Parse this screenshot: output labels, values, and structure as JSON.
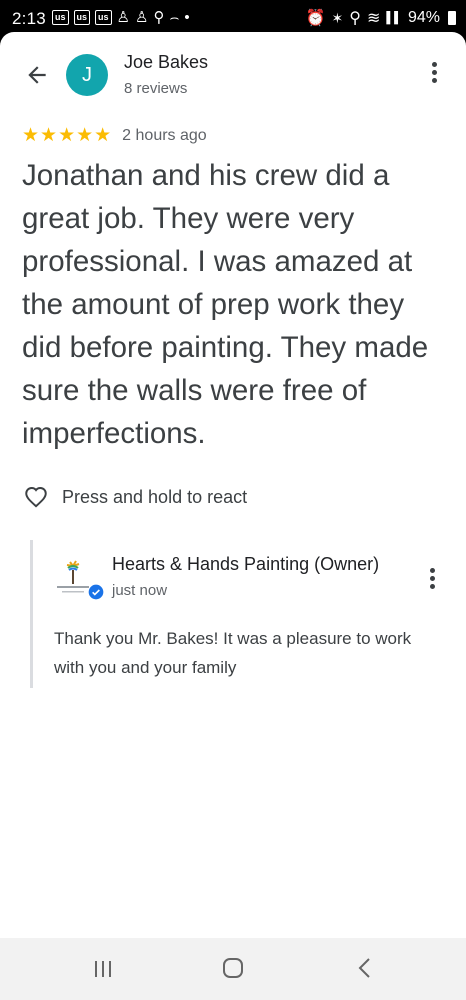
{
  "status_bar": {
    "time": "2:13",
    "carrier_badges": [
      "us",
      "us",
      "us"
    ],
    "battery": "94%",
    "icons": [
      "alarm-icon",
      "bluetooth-icon",
      "location-icon",
      "wifi-icon",
      "signal-icon",
      "battery-icon"
    ]
  },
  "header": {
    "avatar_letter": "J",
    "reviewer_name": "Joe Bakes",
    "reviewer_reviews": "8 reviews"
  },
  "review": {
    "stars": "★★★★★",
    "rating": 5,
    "time": "2 hours ago",
    "text": "Jonathan and his crew did a great job.  They were very professional.  I was amazed at the amount of prep work they did before painting.  They made sure the walls were free of imperfections."
  },
  "react": {
    "label": "Press and hold to react"
  },
  "owner_reply": {
    "name": "Hearts & Hands Painting (Owner)",
    "time": "just now",
    "text": "Thank you Mr. Bakes! It was a pleasure to work with you and your family"
  },
  "colors": {
    "avatar": "#12a5ad",
    "star": "#fbbc04",
    "verified": "#1a73e8"
  }
}
